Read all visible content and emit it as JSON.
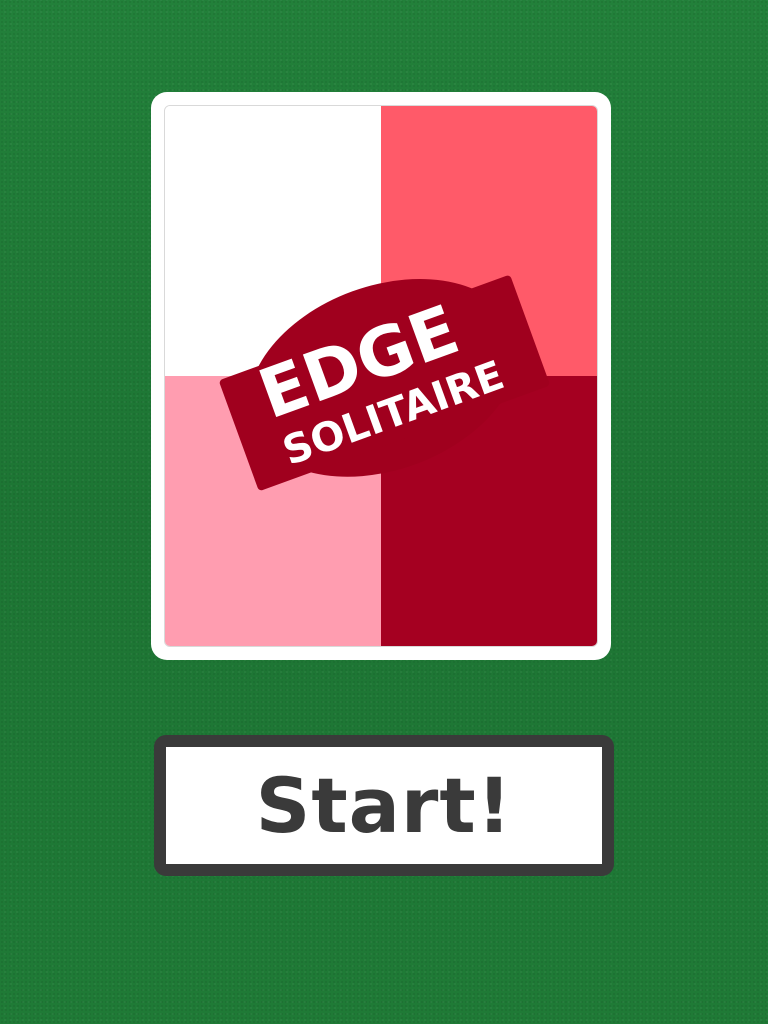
{
  "card": {
    "colors": {
      "top_left": "#ffffff",
      "top_right": "#ff5a69",
      "bottom_left": "#ff9db0",
      "bottom_right": "#a50021",
      "logo_badge": "#a0001e",
      "logo_text": "#ffffff"
    },
    "logo": {
      "line1": "EDGE",
      "line2": "SOLITAIRE"
    }
  },
  "start_button": {
    "label": "Start!"
  },
  "background": {
    "felt_color": "#1f7a36"
  },
  "button_colors": {
    "border": "#3a3a3a",
    "fill": "#ffffff",
    "text": "#3a3a3a"
  }
}
